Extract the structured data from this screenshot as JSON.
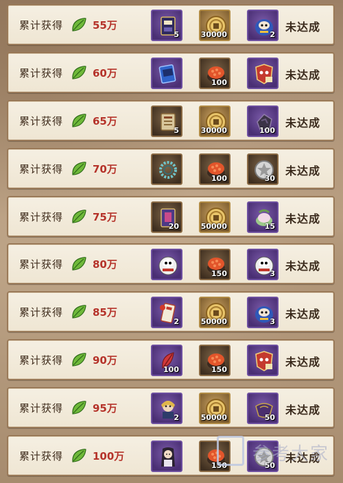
{
  "label_text": "累计获得",
  "status_text": "未达成",
  "rows": [
    {
      "amount": "55万",
      "items": [
        {
          "icon": "purple-card-pack-icon",
          "count": "5",
          "frame": "purple"
        },
        {
          "icon": "gold-coin-icon",
          "count": "30000",
          "frame": "gold"
        },
        {
          "icon": "blue-daruma-icon",
          "count": "2",
          "frame": "purple"
        }
      ]
    },
    {
      "amount": "60万",
      "items": [
        {
          "icon": "blue-card-pack-icon",
          "count": "",
          "frame": "purple"
        },
        {
          "icon": "sushi-stamina-icon",
          "count": "100",
          "frame": "brown"
        },
        {
          "icon": "awakening-mask-icon",
          "count": "",
          "frame": "purple"
        }
      ]
    },
    {
      "amount": "65万",
      "items": [
        {
          "icon": "scroll-ticket-icon",
          "count": "5",
          "frame": "brown"
        },
        {
          "icon": "gold-coin-icon",
          "count": "30000",
          "frame": "gold"
        },
        {
          "icon": "black-jade-icon",
          "count": "100",
          "frame": "purple"
        }
      ]
    },
    {
      "amount": "70万",
      "items": [
        {
          "icon": "prayer-beads-icon",
          "count": "",
          "frame": "brown"
        },
        {
          "icon": "sushi-stamina-icon",
          "count": "100",
          "frame": "brown"
        },
        {
          "icon": "silver-medal-icon",
          "count": "30",
          "frame": "brown"
        }
      ]
    },
    {
      "amount": "75万",
      "items": [
        {
          "icon": "purple-book-icon",
          "count": "20",
          "frame": "brown"
        },
        {
          "icon": "gold-coin-icon",
          "count": "50000",
          "frame": "gold"
        },
        {
          "icon": "mochi-icon",
          "count": "15",
          "frame": "purple"
        }
      ]
    },
    {
      "amount": "80万",
      "items": [
        {
          "icon": "white-daruma-icon",
          "count": "",
          "frame": "purple"
        },
        {
          "icon": "sushi-stamina-icon",
          "count": "150",
          "frame": "brown"
        },
        {
          "icon": "white-daruma-icon",
          "count": "3",
          "frame": "purple"
        }
      ]
    },
    {
      "amount": "85万",
      "items": [
        {
          "icon": "talisman-ticket-icon",
          "count": "2",
          "frame": "purple"
        },
        {
          "icon": "gold-coin-icon",
          "count": "50000",
          "frame": "gold"
        },
        {
          "icon": "blue-daruma-icon",
          "count": "3",
          "frame": "purple"
        }
      ]
    },
    {
      "amount": "90万",
      "items": [
        {
          "icon": "red-feather-icon",
          "count": "100",
          "frame": "purple"
        },
        {
          "icon": "sushi-stamina-icon",
          "count": "150",
          "frame": "brown"
        },
        {
          "icon": "awakening-mask-icon",
          "count": "",
          "frame": "purple"
        }
      ]
    },
    {
      "amount": "95万",
      "items": [
        {
          "icon": "shikigami-portrait-icon",
          "count": "2",
          "frame": "purple"
        },
        {
          "icon": "gold-coin-icon",
          "count": "50000",
          "frame": "gold"
        },
        {
          "icon": "purple-cloth-icon",
          "count": "50",
          "frame": "purple"
        }
      ]
    },
    {
      "amount": "100万",
      "items": [
        {
          "icon": "skin-portrait-icon",
          "count": "",
          "frame": "purple"
        },
        {
          "icon": "sushi-stamina-icon",
          "count": "150",
          "frame": "brown"
        },
        {
          "icon": "silver-medal-icon",
          "count": "50",
          "frame": "purple"
        }
      ]
    }
  ],
  "watermark": {
    "text": "参考大家"
  },
  "colors": {
    "amount": "#b5332a",
    "panel": "#f3ecde",
    "border": "#9a7a59"
  }
}
